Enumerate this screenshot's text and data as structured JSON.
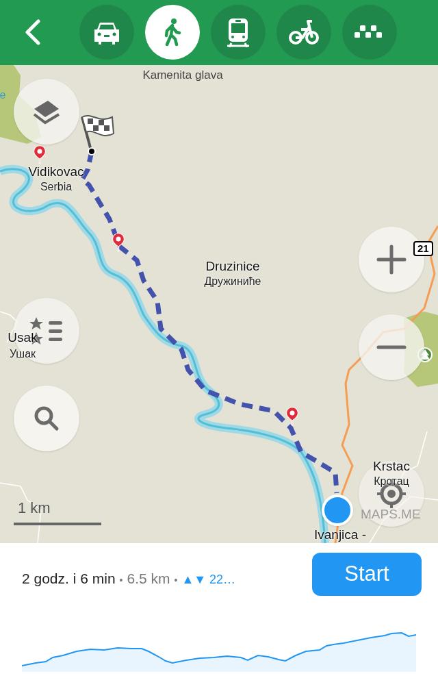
{
  "header": {
    "tabs": [
      {
        "kind": "car",
        "selected": false
      },
      {
        "kind": "walk",
        "selected": true
      },
      {
        "kind": "transit",
        "selected": false
      },
      {
        "kind": "bike",
        "selected": false
      },
      {
        "kind": "taxi",
        "selected": false
      }
    ]
  },
  "map": {
    "labels": [
      {
        "text": "Kamenita glava",
        "kind": "minor"
      },
      {
        "text": "Vidikovac",
        "kind": "major"
      },
      {
        "text": "Serbia",
        "kind": "sub"
      },
      {
        "text": "Druzinice",
        "kind": "major"
      },
      {
        "text": "Дружиниће",
        "kind": "sub"
      },
      {
        "text": "Usak",
        "kind": "major"
      },
      {
        "text": "Ушак",
        "kind": "sub"
      },
      {
        "text": "Krstac",
        "kind": "major"
      },
      {
        "text": "Крстац",
        "kind": "sub"
      },
      {
        "text": "Ivanjica -",
        "kind": "major"
      },
      {
        "text": "e",
        "kind": "water"
      }
    ],
    "road_number": "21",
    "scale": "1 km",
    "logo": "MAPS.ME"
  },
  "route_summary": {
    "time": "2 godz. i 6 min",
    "separator_1": "•",
    "distance": "6.5 km",
    "separator_2": "•",
    "elevation": "▲▼ 22…"
  },
  "start_button": "Start"
}
